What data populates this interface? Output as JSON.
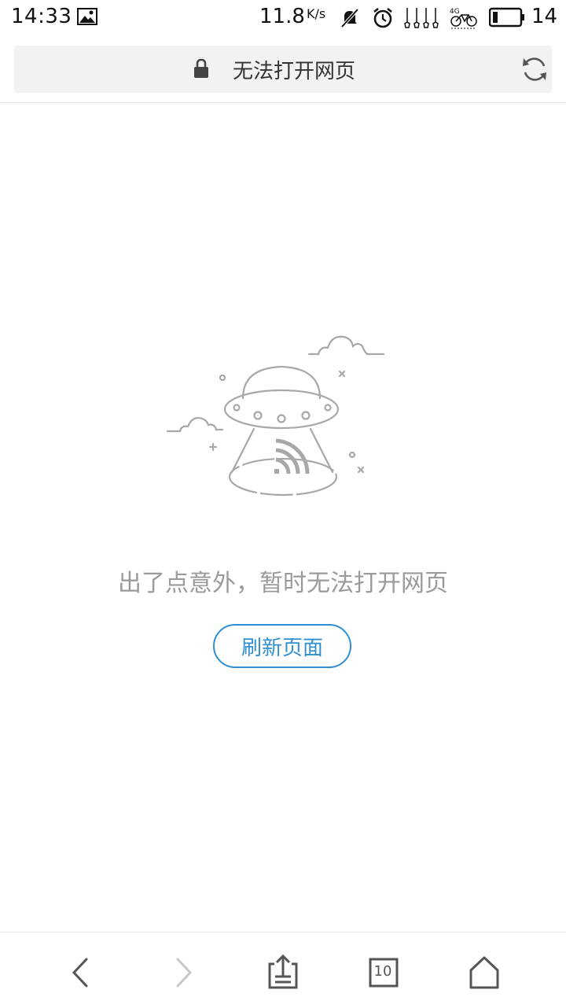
{
  "status_bar": {
    "time": "14:33",
    "net_speed": "11.8",
    "net_speed_unit": "K/s",
    "battery": "14",
    "icons": [
      "image-icon",
      "bell-muted-icon",
      "alarm-icon",
      "notification-bells-icon",
      "bike-4g-icon",
      "battery-icon"
    ]
  },
  "address_bar": {
    "title": "无法打开网页",
    "lock_icon": "lock-icon",
    "refresh_icon": "refresh-icon"
  },
  "error": {
    "illustration": "ufo-illustration",
    "message": "出了点意外，暂时无法打开网页",
    "refresh_button": "刷新页面",
    "accent_color": "#2f8fd2"
  },
  "toolbar": {
    "back_icon": "back-icon",
    "forward_icon": "forward-icon",
    "share_icon": "share-icon",
    "tab_count": "10",
    "home_icon": "home-icon"
  }
}
